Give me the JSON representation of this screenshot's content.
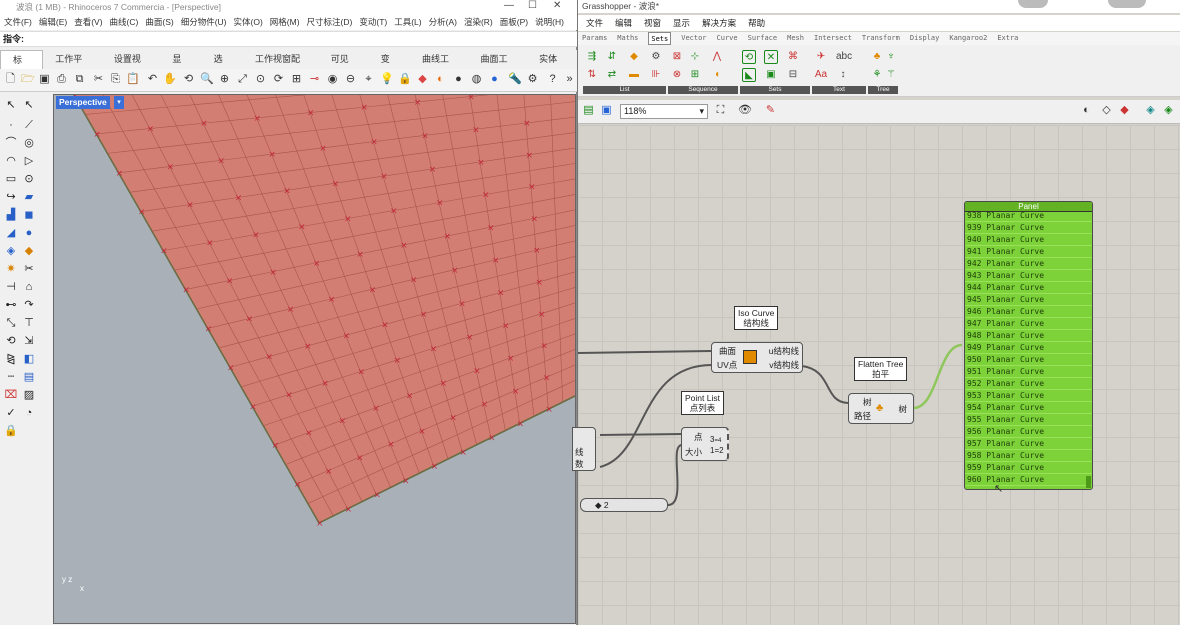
{
  "rhino": {
    "title": "波浪 (1 MB) - Rhinoceros 7 Commercia - [Perspective]",
    "menu": [
      "文件(F)",
      "编辑(E)",
      "查看(V)",
      "曲线(C)",
      "曲面(S)",
      "细分物件(U)",
      "实体(O)",
      "网格(M)",
      "尺寸标注(D)",
      "变动(T)",
      "工具(L)",
      "分析(A)",
      "渲染(R)",
      "面板(P)",
      "说明(H)"
    ],
    "command_label": "指令:",
    "tabs": [
      "标准",
      "工作平面",
      "设置视图",
      "显示",
      "选取",
      "工作视窗配置",
      "可见性",
      "变动",
      "曲线工具",
      "曲面工具",
      "实体工"
    ],
    "viewport_label": "Perspective",
    "axis_labels": [
      "y",
      "z",
      "x"
    ],
    "colors": {
      "surface": "#d97a6d",
      "background": "#a9b0b8",
      "accent": "#3a6fd8"
    }
  },
  "gh": {
    "title": "Grasshopper - 波浪*",
    "menu": [
      "文件",
      "编辑",
      "视窗",
      "显示",
      "解决方案",
      "帮助"
    ],
    "tabs": [
      "Params",
      "Maths",
      "Sets",
      "Vector",
      "Curve",
      "Surface",
      "Mesh",
      "Intersect",
      "Transform",
      "Display",
      "Kangaroo2",
      "Extra"
    ],
    "active_tab": "Sets",
    "groups": [
      "List",
      "Sequence",
      "Sets",
      "Text",
      "Tree"
    ],
    "zoom": "118%",
    "iso_curve": {
      "tip_en": "Iso Curve",
      "tip_cn": "结构线",
      "in1": "曲面",
      "in2": "UV点",
      "out1": "u结构线",
      "out2": "v结构线"
    },
    "flatten": {
      "tip_en": "Flatten Tree",
      "tip_cn": "拍平",
      "in1": "树",
      "in2": "路径",
      "out": "树"
    },
    "point_list": {
      "tip_en": "Point List",
      "tip_cn": "点列表",
      "in1": "点",
      "in2": "大小"
    },
    "partial_labels": [
      "线",
      "数"
    ],
    "slider": "◆ 2",
    "panel": {
      "title": "Panel",
      "rows": [
        "938 Planar Curve",
        "939 Planar Curve",
        "940 Planar Curve",
        "941 Planar Curve",
        "942 Planar Curve",
        "943 Planar Curve",
        "944 Planar Curve",
        "945 Planar Curve",
        "946 Planar Curve",
        "947 Planar Curve",
        "948 Planar Curve",
        "949 Planar Curve",
        "950 Planar Curve",
        "951 Planar Curve",
        "952 Planar Curve",
        "953 Planar Curve",
        "954 Planar Curve",
        "955 Planar Curve",
        "956 Planar Curve",
        "957 Planar Curve",
        "958 Planar Curve",
        "959 Planar Curve",
        "960 Planar Curve"
      ]
    }
  }
}
